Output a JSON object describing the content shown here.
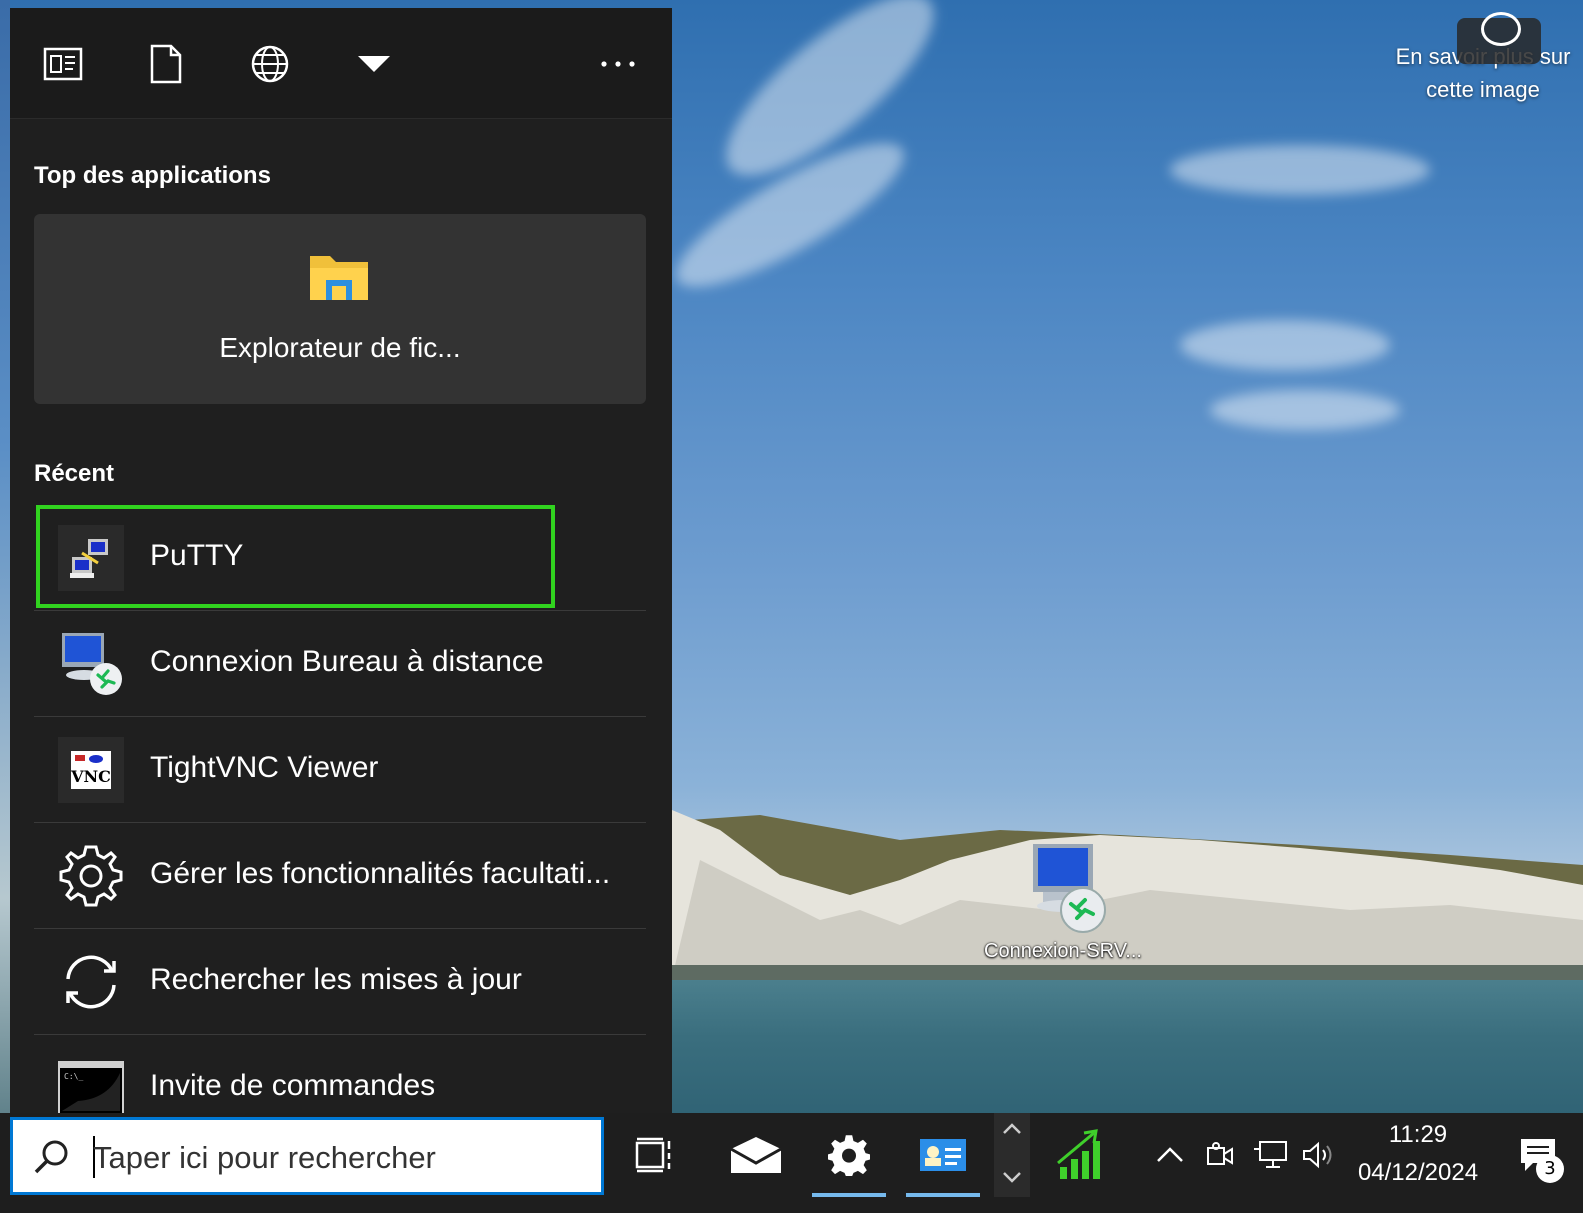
{
  "desktop": {
    "wallpaper_info": "En savoir plus sur cette image",
    "icons": [
      {
        "label": "Connexion-SRV..."
      }
    ]
  },
  "start_menu": {
    "toolbar": [
      "news-icon",
      "document-icon",
      "globe-icon",
      "dropdown-icon",
      "more-icon"
    ],
    "top_apps_title": "Top des applications",
    "top_app": {
      "label": "Explorateur de fic...",
      "icon": "folder-icon"
    },
    "recent_title": "Récent",
    "recent_items": [
      {
        "label": "PuTTY",
        "icon": "putty-icon",
        "highlighted": true
      },
      {
        "label": "Connexion Bureau à distance",
        "icon": "remote-desktop-icon"
      },
      {
        "label": "TightVNC Viewer",
        "icon": "tightvnc-icon"
      },
      {
        "label": "Gérer les fonctionnalités facultati...",
        "icon": "gear-icon"
      },
      {
        "label": "Rechercher les mises à jour",
        "icon": "refresh-icon"
      },
      {
        "label": "Invite de commandes",
        "icon": "cmd-icon"
      }
    ]
  },
  "taskbar": {
    "search_placeholder": "Taper ici pour rechercher",
    "clock": {
      "time": "11:29",
      "date": "04/12/2024"
    },
    "notification_count": "3"
  },
  "colors": {
    "highlight": "#31d31f",
    "menu_bg": "#1f1f1f",
    "search_border": "#0078d4",
    "active_indicator": "#76b9ed"
  }
}
